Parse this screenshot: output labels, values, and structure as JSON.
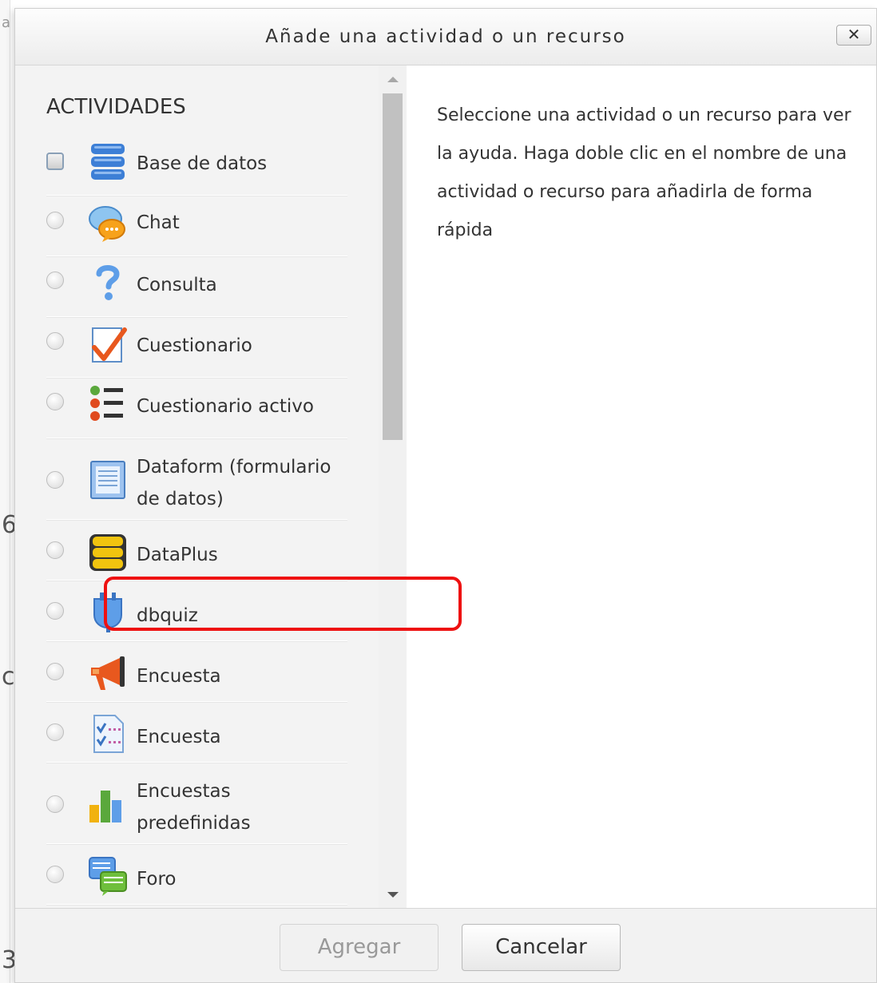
{
  "dialog": {
    "title": "Añade una actividad o un recurso",
    "close_label": "✕"
  },
  "background": {
    "marks": [
      "a",
      "6",
      "c",
      "3"
    ]
  },
  "section": {
    "heading": "ACTIVIDADES"
  },
  "activities": [
    {
      "label": "Base de datos",
      "icon": "database-icon",
      "selected": true
    },
    {
      "label": "Chat",
      "icon": "chat-icon",
      "selected": false
    },
    {
      "label": "Consulta",
      "icon": "question-icon",
      "selected": false
    },
    {
      "label": "Cuestionario",
      "icon": "quiz-icon",
      "selected": false
    },
    {
      "label": "Cuestionario activo",
      "icon": "list-icon",
      "selected": false
    },
    {
      "label_lines": [
        "Dataform (formulario",
        "de datos)"
      ],
      "icon": "form-icon",
      "selected": false
    },
    {
      "label": "DataPlus",
      "icon": "dataplus-icon",
      "selected": false
    },
    {
      "label": "dbquiz",
      "icon": "plugin-icon",
      "selected": false
    },
    {
      "label": "Encuesta",
      "icon": "megaphone-icon",
      "selected": false
    },
    {
      "label": "Encuesta",
      "icon": "survey-icon",
      "selected": false
    },
    {
      "label_lines": [
        "Encuestas",
        "predefinidas"
      ],
      "icon": "bar-chart-icon",
      "selected": false
    },
    {
      "label": "Foro",
      "icon": "forum-icon",
      "selected": false
    }
  ],
  "help": {
    "text": "Seleccione una actividad o un recurso para ver la ayuda. Haga doble clic en el nombre de una actividad o recurso para añadirla de forma rápida"
  },
  "buttons": {
    "add_label": "Agregar",
    "cancel_label": "Cancelar"
  },
  "colors": {
    "highlight": "#ee1111",
    "accent_blue": "#3d7fd6"
  }
}
